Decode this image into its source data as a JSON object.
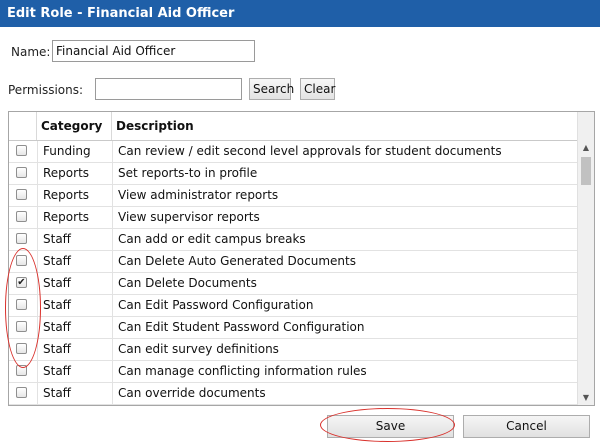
{
  "window": {
    "title": "Edit Role - Financial Aid Officer"
  },
  "name_field": {
    "label": "Name:",
    "value": "Financial Aid Officer"
  },
  "permissions": {
    "label": "Permissions:",
    "value": "",
    "search_label": "Search",
    "clear_label": "Clear"
  },
  "grid": {
    "headers": {
      "category": "Category",
      "description": "Description"
    },
    "rows": [
      {
        "checked": false,
        "category": "Funding",
        "description": "Can review / edit second level approvals for student documents"
      },
      {
        "checked": false,
        "category": "Reports",
        "description": "Set reports-to in profile"
      },
      {
        "checked": false,
        "category": "Reports",
        "description": "View administrator reports"
      },
      {
        "checked": false,
        "category": "Reports",
        "description": "View supervisor reports"
      },
      {
        "checked": false,
        "category": "Staff",
        "description": "Can add or edit campus breaks"
      },
      {
        "checked": false,
        "category": "Staff",
        "description": "Can Delete Auto Generated Documents"
      },
      {
        "checked": true,
        "category": "Staff",
        "description": "Can Delete Documents"
      },
      {
        "checked": false,
        "category": "Staff",
        "description": "Can Edit Password Configuration"
      },
      {
        "checked": false,
        "category": "Staff",
        "description": "Can Edit Student Password Configuration"
      },
      {
        "checked": false,
        "category": "Staff",
        "description": "Can edit survey definitions"
      },
      {
        "checked": false,
        "category": "Staff",
        "description": "Can manage conflicting information rules"
      },
      {
        "checked": false,
        "category": "Staff",
        "description": "Can override documents"
      }
    ]
  },
  "footer": {
    "save_label": "Save",
    "cancel_label": "Cancel"
  },
  "annotation_color": "#d9312c"
}
